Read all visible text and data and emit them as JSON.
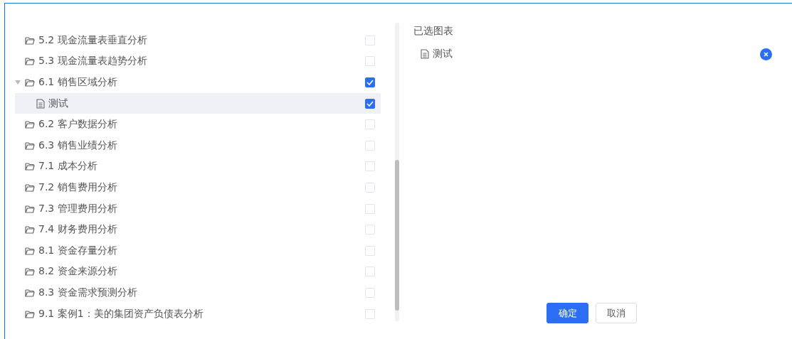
{
  "tree": [
    {
      "label": "5.2 现金流量表垂直分析",
      "checked": false,
      "selected": false
    },
    {
      "label": "5.3 现金流量表趋势分析",
      "checked": false,
      "selected": false
    },
    {
      "label": "6.1 销售区域分析",
      "checked": true,
      "selected": false,
      "expanded": true,
      "children": [
        {
          "label": "测试",
          "checked": true,
          "selected": true
        }
      ]
    },
    {
      "label": "6.2 客户数据分析",
      "checked": false,
      "selected": false
    },
    {
      "label": "6.3 销售业绩分析",
      "checked": false,
      "selected": false
    },
    {
      "label": "7.1 成本分析",
      "checked": false,
      "selected": false
    },
    {
      "label": "7.2 销售费用分析",
      "checked": false,
      "selected": false
    },
    {
      "label": "7.3 管理费用分析",
      "checked": false,
      "selected": false
    },
    {
      "label": "7.4 财务费用分析",
      "checked": false,
      "selected": false
    },
    {
      "label": "8.1 资金存量分析",
      "checked": false,
      "selected": false
    },
    {
      "label": "8.2 资金来源分析",
      "checked": false,
      "selected": false
    },
    {
      "label": "8.3 资金需求预测分析",
      "checked": false,
      "selected": false
    },
    {
      "label": "9.1 案例1：美的集团资产负债表分析",
      "checked": false,
      "selected": false
    }
  ],
  "selected_panel": {
    "title": "已选图表",
    "items": [
      {
        "label": "测试"
      }
    ]
  },
  "buttons": [
    {
      "label": "确定",
      "kind": "primary"
    },
    {
      "label": "取消",
      "kind": "default"
    }
  ]
}
